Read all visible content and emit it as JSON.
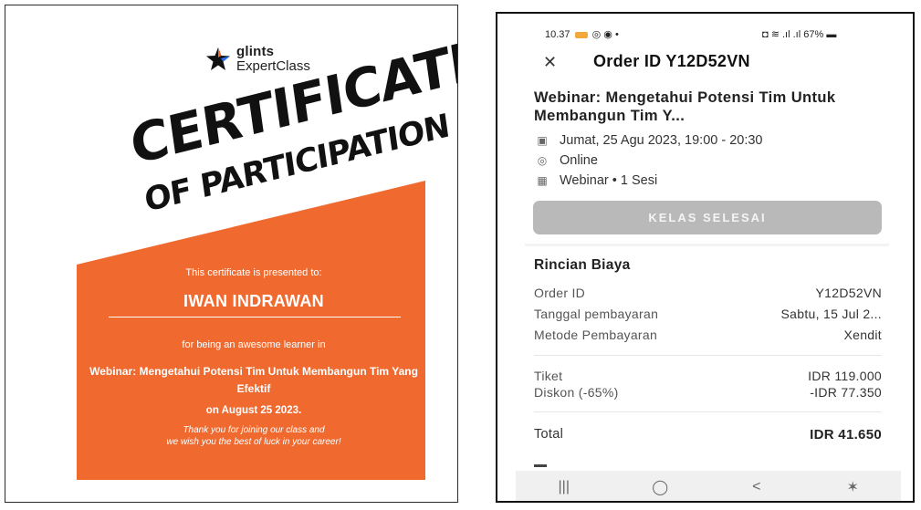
{
  "certificate": {
    "brand_line1": "glints",
    "brand_line2": "ExpertClass",
    "title_line1": "CERTIFICATE",
    "title_line2": "OF PARTICIPATION",
    "presented_text": "This certificate is presented to:",
    "recipient": "IWAN INDRAWAN",
    "being_text": "for being an awesome learner in",
    "course_title": "Webinar: Mengetahui Potensi Tim Untuk Membangun Tim Yang Efektif",
    "date_text": "on August 25 2023.",
    "thanks_line1": "Thank you for joining our class and",
    "thanks_line2": "we wish you the best of luck in your career!",
    "colors": {
      "orange": "#f06a30",
      "ink": "#111111"
    }
  },
  "phone": {
    "status": {
      "time": "10.37",
      "right": "67%"
    },
    "header": {
      "close_icon": "close-icon",
      "title": "Order ID Y12D52VN"
    },
    "webinar": {
      "title": "Webinar: Mengetahui Potensi Tim Untuk Membangun Tim Y...",
      "schedule": "Jumat, 25 Agu 2023, 19:00 - 20:30",
      "location": "Online",
      "type": "Webinar • 1 Sesi"
    },
    "button_label": "KELAS SELESAI",
    "cost": {
      "heading": "Rincian Biaya",
      "rows": [
        {
          "label": "Order ID",
          "value": "Y12D52VN"
        },
        {
          "label": "Tanggal pembayaran",
          "value": "Sabtu, 15 Jul 2..."
        },
        {
          "label": "Metode Pembayaran",
          "value": "Xendit"
        }
      ],
      "ticket_label": "Tiket",
      "ticket_value": "IDR 119.000",
      "discount_label": "Diskon (-65%)",
      "discount_value": "-IDR 77.350",
      "total_label": "Total",
      "total_value": "IDR 41.650"
    },
    "nav": {
      "recent": "|||",
      "home": "◯",
      "back": "<",
      "accessibility": "✶"
    },
    "colors": {
      "button_bg": "#b9b9b9",
      "nav_bg": "#f0f0f0"
    }
  }
}
